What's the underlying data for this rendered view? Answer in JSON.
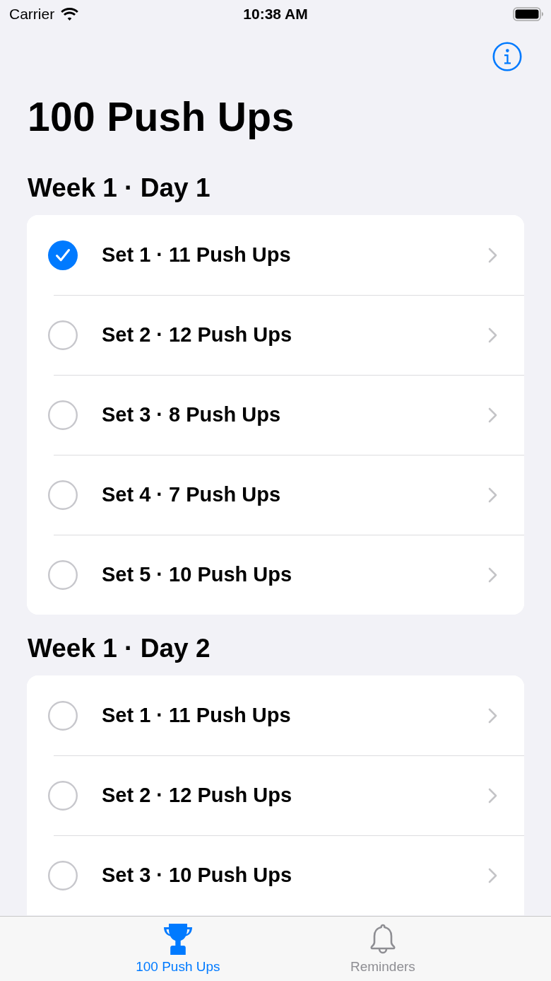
{
  "status_bar": {
    "carrier": "Carrier",
    "time": "10:38 AM"
  },
  "title": "100 Push Ups",
  "sections": [
    {
      "header": "Week 1 · Day 1",
      "sets": [
        {
          "label": "Set 1 · 11 Push Ups",
          "checked": true
        },
        {
          "label": "Set 2 · 12 Push Ups",
          "checked": false
        },
        {
          "label": "Set 3 · 8 Push Ups",
          "checked": false
        },
        {
          "label": "Set 4 · 7 Push Ups",
          "checked": false
        },
        {
          "label": "Set 5 · 10 Push Ups",
          "checked": false
        }
      ]
    },
    {
      "header": "Week 1 · Day 2",
      "sets": [
        {
          "label": "Set 1 · 11 Push Ups",
          "checked": false
        },
        {
          "label": "Set 2 · 12 Push Ups",
          "checked": false
        },
        {
          "label": "Set 3 · 10 Push Ups",
          "checked": false
        }
      ]
    }
  ],
  "tab_bar": {
    "tabs": [
      {
        "label": "100 Push Ups",
        "kind": "workouts",
        "selected": true
      },
      {
        "label": "Reminders",
        "kind": "reminders",
        "selected": false
      }
    ]
  }
}
